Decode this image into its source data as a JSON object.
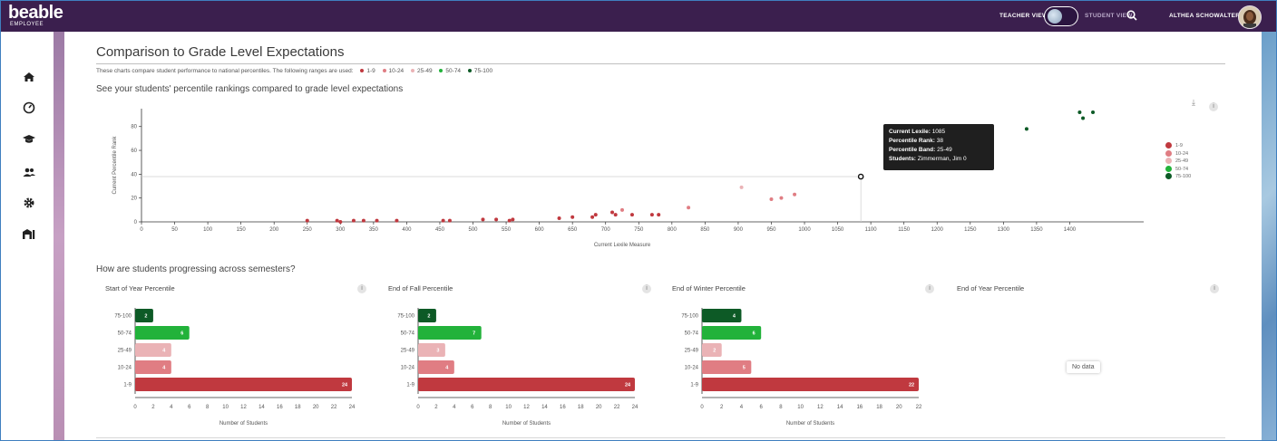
{
  "app": {
    "logo": "beable",
    "logo_sub": "EMPLOYEE",
    "teacher_view_label": "TEACHER VIEW",
    "student_view_label": "STUDENT VIEW",
    "user_name": "ALTHEA SCHOWALTER"
  },
  "nav": {
    "icons": [
      "home-icon",
      "gauge-icon",
      "graduation-cap-icon",
      "users-icon",
      "gear-icon",
      "library-icon"
    ]
  },
  "page": {
    "title": "Comparison to Grade Level Expectations",
    "description": "These charts compare student performance to national percentiles. The following ranges are used:",
    "ranges": [
      "1-9",
      "10-24",
      "25-49",
      "50-74",
      "75-100"
    ],
    "colors": {
      "1-9": "#c0393f",
      "10-24": "#e07d83",
      "25-49": "#eab3b6",
      "50-74": "#22b23a",
      "75-100": "#0d5a26"
    },
    "subtitle_scatter": "See your students' percentile rankings compared to grade level expectations",
    "subtitle_bars": "How are students progressing across semesters?"
  },
  "tooltip": {
    "line1_label": "Current Lexile:",
    "line1_value": "1085",
    "line2_label": "Percentile Rank:",
    "line2_value": "38",
    "line3_label": "Percentile Band:",
    "line3_value": "25-49",
    "line4_label": "Students:",
    "line4_value": "Zimmerman, Jim 0"
  },
  "no_data": "No data",
  "chart_data": [
    {
      "type": "scatter",
      "title": "",
      "xlabel": "Current Lexile Measure",
      "ylabel": "Current Percentile Rank",
      "xlim": [
        0,
        1450
      ],
      "ylim": [
        0,
        95
      ],
      "xticks": [
        0,
        50,
        100,
        150,
        200,
        250,
        300,
        350,
        400,
        450,
        500,
        550,
        600,
        650,
        700,
        750,
        800,
        850,
        900,
        950,
        1000,
        1050,
        1100,
        1150,
        1200,
        1250,
        1300,
        1350,
        1400
      ],
      "yticks": [
        0,
        20,
        40,
        60,
        80
      ],
      "legend_position": "right",
      "points": [
        {
          "x": 250,
          "y": 1,
          "band": "1-9"
        },
        {
          "x": 295,
          "y": 1,
          "band": "1-9"
        },
        {
          "x": 300,
          "y": 0,
          "band": "1-9"
        },
        {
          "x": 320,
          "y": 1,
          "band": "1-9"
        },
        {
          "x": 335,
          "y": 1,
          "band": "1-9"
        },
        {
          "x": 355,
          "y": 1,
          "band": "1-9"
        },
        {
          "x": 385,
          "y": 1,
          "band": "1-9"
        },
        {
          "x": 455,
          "y": 1,
          "band": "1-9"
        },
        {
          "x": 465,
          "y": 1,
          "band": "1-9"
        },
        {
          "x": 515,
          "y": 2,
          "band": "1-9"
        },
        {
          "x": 535,
          "y": 2,
          "band": "1-9"
        },
        {
          "x": 555,
          "y": 1,
          "band": "1-9"
        },
        {
          "x": 560,
          "y": 2,
          "band": "1-9"
        },
        {
          "x": 630,
          "y": 3,
          "band": "1-9"
        },
        {
          "x": 650,
          "y": 4,
          "band": "1-9"
        },
        {
          "x": 680,
          "y": 4,
          "band": "1-9"
        },
        {
          "x": 685,
          "y": 6,
          "band": "1-9"
        },
        {
          "x": 710,
          "y": 8,
          "band": "1-9"
        },
        {
          "x": 715,
          "y": 6,
          "band": "1-9"
        },
        {
          "x": 740,
          "y": 6,
          "band": "1-9"
        },
        {
          "x": 770,
          "y": 6,
          "band": "1-9"
        },
        {
          "x": 780,
          "y": 6,
          "band": "1-9"
        },
        {
          "x": 725,
          "y": 10,
          "band": "10-24"
        },
        {
          "x": 825,
          "y": 12,
          "band": "10-24"
        },
        {
          "x": 905,
          "y": 29,
          "band": "25-49"
        },
        {
          "x": 950,
          "y": 19,
          "band": "10-24"
        },
        {
          "x": 965,
          "y": 20,
          "band": "10-24"
        },
        {
          "x": 985,
          "y": 23,
          "band": "10-24"
        },
        {
          "x": 1085,
          "y": 38,
          "band": "25-49",
          "highlight": true
        },
        {
          "x": 1220,
          "y": 61,
          "band": "50-74"
        },
        {
          "x": 1235,
          "y": 73,
          "band": "50-74"
        },
        {
          "x": 1270,
          "y": 69,
          "band": "50-74"
        },
        {
          "x": 1335,
          "y": 78,
          "band": "75-100"
        },
        {
          "x": 1415,
          "y": 92,
          "band": "75-100"
        },
        {
          "x": 1420,
          "y": 87,
          "band": "75-100"
        },
        {
          "x": 1435,
          "y": 92,
          "band": "75-100"
        }
      ]
    },
    {
      "type": "bar",
      "title": "Start of Year Percentile",
      "xlabel": "Number of Students",
      "categories": [
        "75-100",
        "50-74",
        "25-49",
        "10-24",
        "1-9"
      ],
      "values": [
        2,
        6,
        4,
        4,
        24
      ],
      "xlim": [
        0,
        24
      ],
      "xticks": [
        0,
        2,
        4,
        6,
        8,
        10,
        12,
        14,
        16,
        18,
        20,
        22,
        24
      ]
    },
    {
      "type": "bar",
      "title": "End of Fall Percentile",
      "xlabel": "Number of Students",
      "categories": [
        "75-100",
        "50-74",
        "25-49",
        "10-24",
        "1-9"
      ],
      "values": [
        2,
        7,
        3,
        4,
        24
      ],
      "xlim": [
        0,
        24
      ],
      "xticks": [
        0,
        2,
        4,
        6,
        8,
        10,
        12,
        14,
        16,
        18,
        20,
        22,
        24
      ]
    },
    {
      "type": "bar",
      "title": "End of Winter Percentile",
      "xlabel": "Number of Students",
      "categories": [
        "75-100",
        "50-74",
        "25-49",
        "10-24",
        "1-9"
      ],
      "values": [
        4,
        6,
        2,
        5,
        22
      ],
      "xlim": [
        0,
        22
      ],
      "xticks": [
        0,
        2,
        4,
        6,
        8,
        10,
        12,
        14,
        16,
        18,
        20,
        22
      ]
    },
    {
      "type": "bar",
      "title": "End of Year Percentile",
      "categories": [],
      "values": []
    }
  ]
}
